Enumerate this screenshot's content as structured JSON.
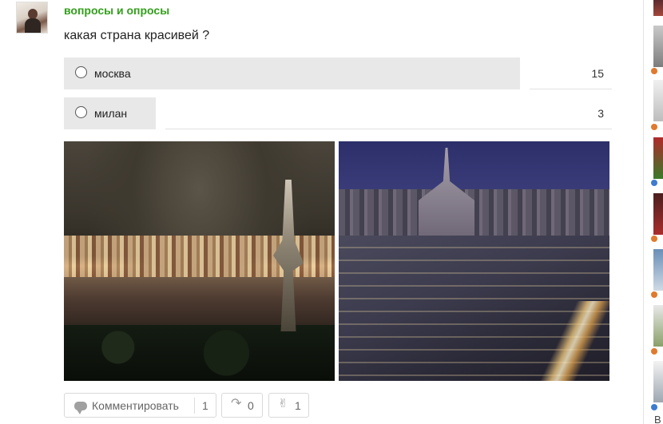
{
  "post": {
    "group_name": "вопросы и опросы",
    "question": "какая страна  красивей ?"
  },
  "poll": {
    "options": [
      {
        "label": "москва",
        "votes": "15",
        "share": 0.83
      },
      {
        "label": "милан",
        "votes": "3",
        "share": 0.17
      }
    ]
  },
  "photos": [
    {
      "name": "moscow-night-photo"
    },
    {
      "name": "milan-night-photo"
    }
  ],
  "actions": {
    "comment_label": "Комментировать",
    "comment_count": "1",
    "share_count": "0",
    "like_count": "1"
  },
  "sidebar": {
    "truncated_text": "В"
  }
}
